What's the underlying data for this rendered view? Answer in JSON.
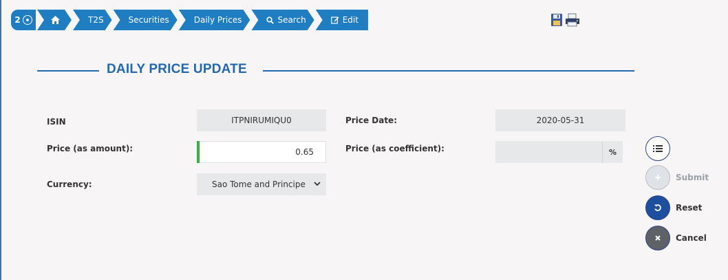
{
  "breadcrumb": {
    "counter": "2",
    "items": [
      "T2S",
      "Securities",
      "Daily Prices",
      "Search",
      "Edit"
    ]
  },
  "form": {
    "title": "DAILY PRICE UPDATE",
    "isin_label": "ISIN",
    "isin_value": "ITPNIRUMIQU0",
    "price_date_label": "Price Date:",
    "price_date_value": "2020-05-31",
    "price_amount_label": "Price (as amount):",
    "price_amount_value": "0.65",
    "price_coefficient_label": "Price (as coefficient):",
    "price_coefficient_value": "",
    "percent_symbol": "%",
    "currency_label": "Currency:",
    "currency_value": "Sao Tome and Principe"
  },
  "actions": {
    "submit": "Submit",
    "reset": "Reset",
    "cancel": "Cancel"
  },
  "colors": {
    "accent": "#1f7ec2",
    "title": "#2168b1",
    "reset_button": "#1d4f9e",
    "cancel_button": "#5e6166",
    "input_marker": "#3fae49"
  }
}
